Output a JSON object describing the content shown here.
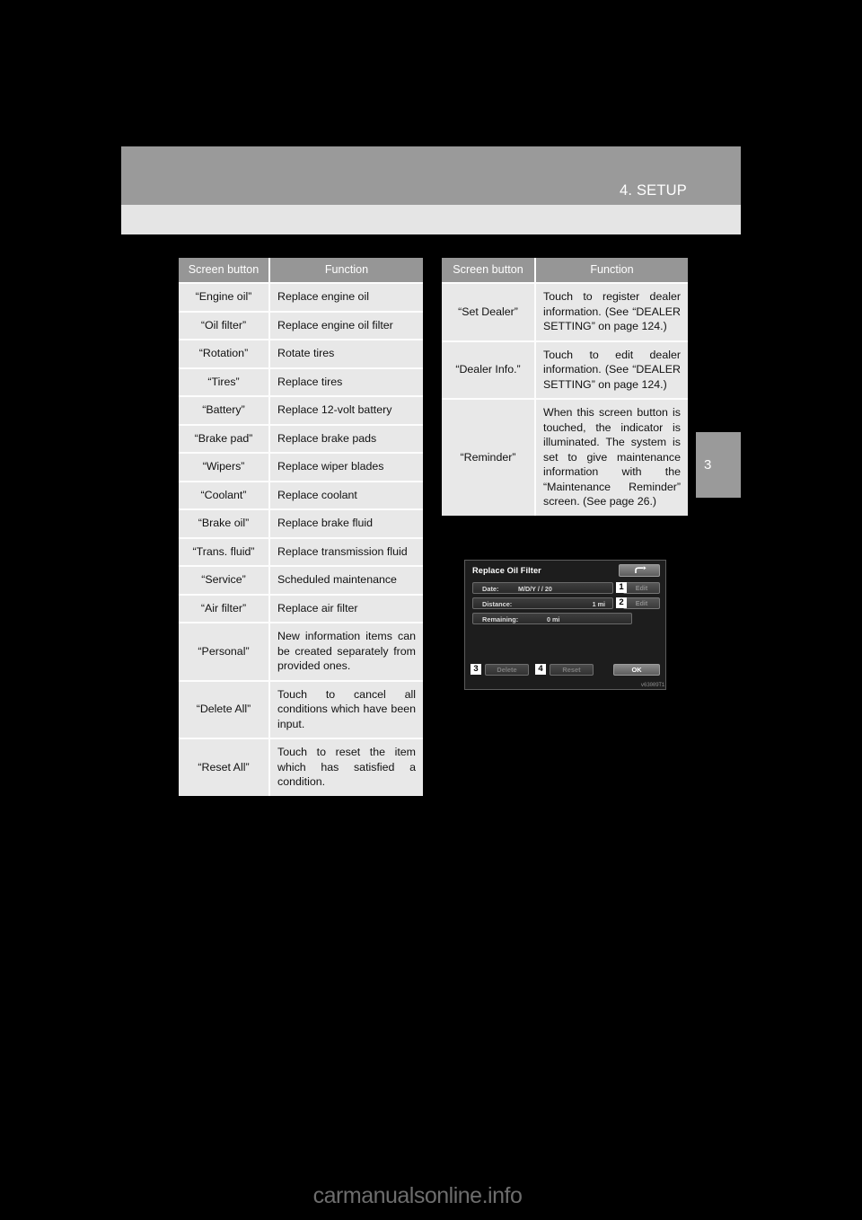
{
  "header": {
    "chapter_title": "4. SETUP",
    "chapter_tab_number": "3"
  },
  "tables": {
    "left": {
      "columns": [
        "Screen button",
        "Function"
      ],
      "rows": [
        {
          "button": "“Engine oil”",
          "function": "Replace engine oil"
        },
        {
          "button": "“Oil filter”",
          "function": "Replace engine oil filter"
        },
        {
          "button": "“Rotation”",
          "function": "Rotate tires"
        },
        {
          "button": "“Tires”",
          "function": "Replace tires"
        },
        {
          "button": "“Battery”",
          "function": "Replace 12-volt battery"
        },
        {
          "button": "“Brake pad”",
          "function": "Replace brake pads"
        },
        {
          "button": "“Wipers”",
          "function": "Replace wiper blades"
        },
        {
          "button": "“Coolant”",
          "function": "Replace coolant"
        },
        {
          "button": "“Brake oil”",
          "function": "Replace brake fluid"
        },
        {
          "button": "“Trans. fluid”",
          "function": "Replace transmission fluid"
        },
        {
          "button": "“Service”",
          "function": "Scheduled maintenance"
        },
        {
          "button": "“Air filter”",
          "function": "Replace air filter"
        },
        {
          "button": "“Personal”",
          "function": "New information items can be created separately from provided ones."
        },
        {
          "button": "“Delete All”",
          "function": "Touch to cancel all conditions which have been input."
        },
        {
          "button": "“Reset All”",
          "function": "Touch to reset the item which has satisfied a condition."
        }
      ]
    },
    "right": {
      "columns": [
        "Screen button",
        "Function"
      ],
      "rows": [
        {
          "button": "“Set Dealer”",
          "function": "Touch to register dealer information. (See “DEALER SETTING” on page 124.)"
        },
        {
          "button": "“Dealer Info.”",
          "function": "Touch to edit dealer information. (See “DEALER SETTING” on page 124.)"
        },
        {
          "button": "“Reminder”",
          "function": "When this screen button is touched, the indicator is illuminated. The system is set to give maintenance information with the “Maintenance Reminder” screen. (See page 26.)"
        }
      ]
    }
  },
  "device_screen": {
    "title": "Replace Oil Filter",
    "back_icon": "back-arrow-icon",
    "rows": [
      {
        "label": "Date:",
        "value": "M/D/Y          /      / 20"
      },
      {
        "label": "Distance:",
        "value": "1 mi"
      },
      {
        "label": "Remaining:",
        "value": "0 mi"
      }
    ],
    "edit_buttons": [
      "Edit",
      "Edit"
    ],
    "buttons": {
      "delete": "Delete",
      "reset": "Reset",
      "ok": "OK"
    },
    "callouts": [
      "1",
      "2",
      "3",
      "4"
    ],
    "figure_code": "v63009T1"
  },
  "watermark": "carmanualsonline.info"
}
